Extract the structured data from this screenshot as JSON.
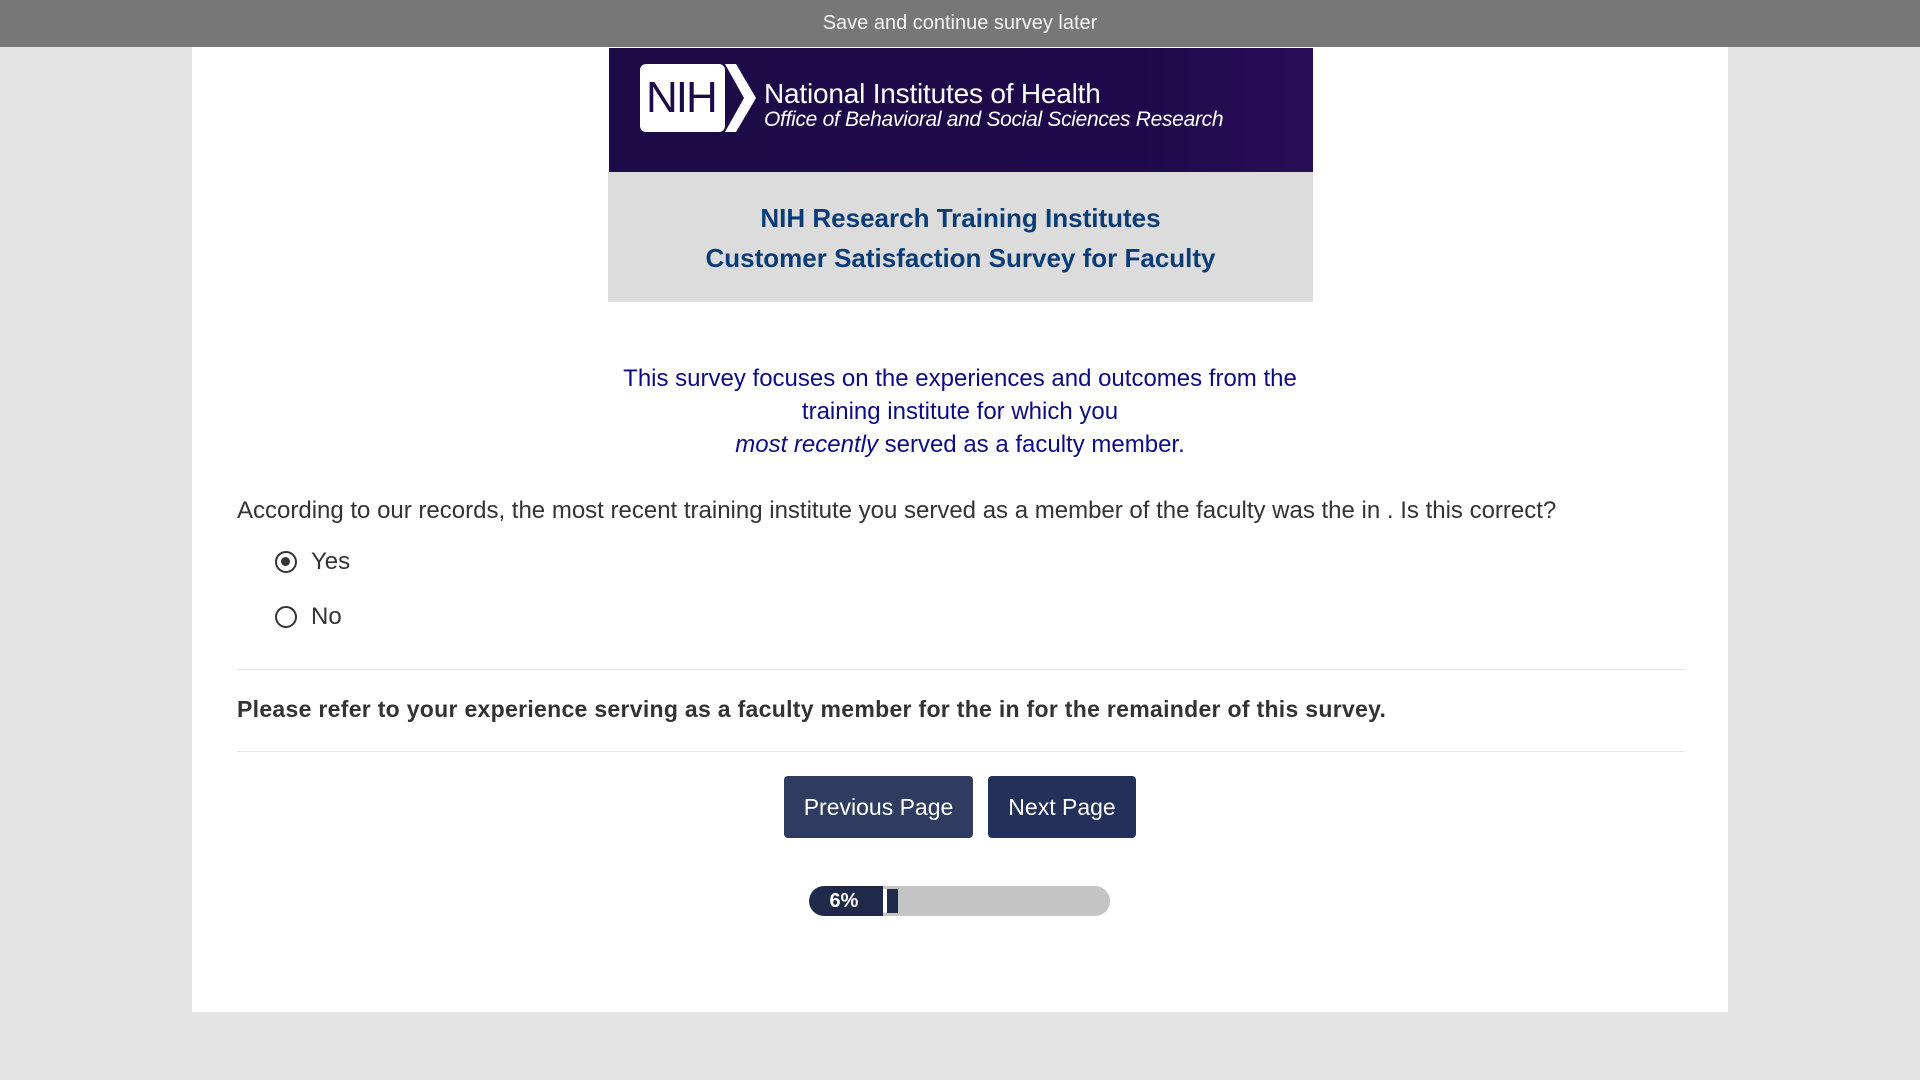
{
  "topbar": {
    "save_later_label": "Save and continue survey later"
  },
  "banner": {
    "logo_text": "NIH",
    "org_name": "National Institutes of Health",
    "office_name": "Office of Behavioral and Social Sciences Research"
  },
  "survey": {
    "title_line1": "NIH Research Training Institutes",
    "title_line2": "Customer Satisfaction Survey for Faculty",
    "intro_line1": "This survey focuses on the experiences and outcomes from the",
    "intro_line2": "training institute for which you",
    "intro_emphasis": "most recently",
    "intro_line3_rest": " served as a faculty member.",
    "question": "According to our records, the most recent training institute you served as a member of the faculty was the  in .  Is this correct?",
    "options": [
      {
        "label": "Yes",
        "selected": true
      },
      {
        "label": "No",
        "selected": false
      }
    ],
    "remainder_note": "Please refer to your experience serving as a faculty member for the  in  for the remainder of this survey."
  },
  "nav": {
    "previous_label": "Previous Page",
    "next_label": "Next Page"
  },
  "progress": {
    "label": "6%",
    "value": 0.06
  },
  "colors": {
    "topbar": "#777777",
    "banner": "#1d0b47",
    "title_text": "#0a3d78",
    "intro_text": "#0c0c86",
    "button": "#22305a",
    "progress_fill": "#1f2a4a"
  }
}
